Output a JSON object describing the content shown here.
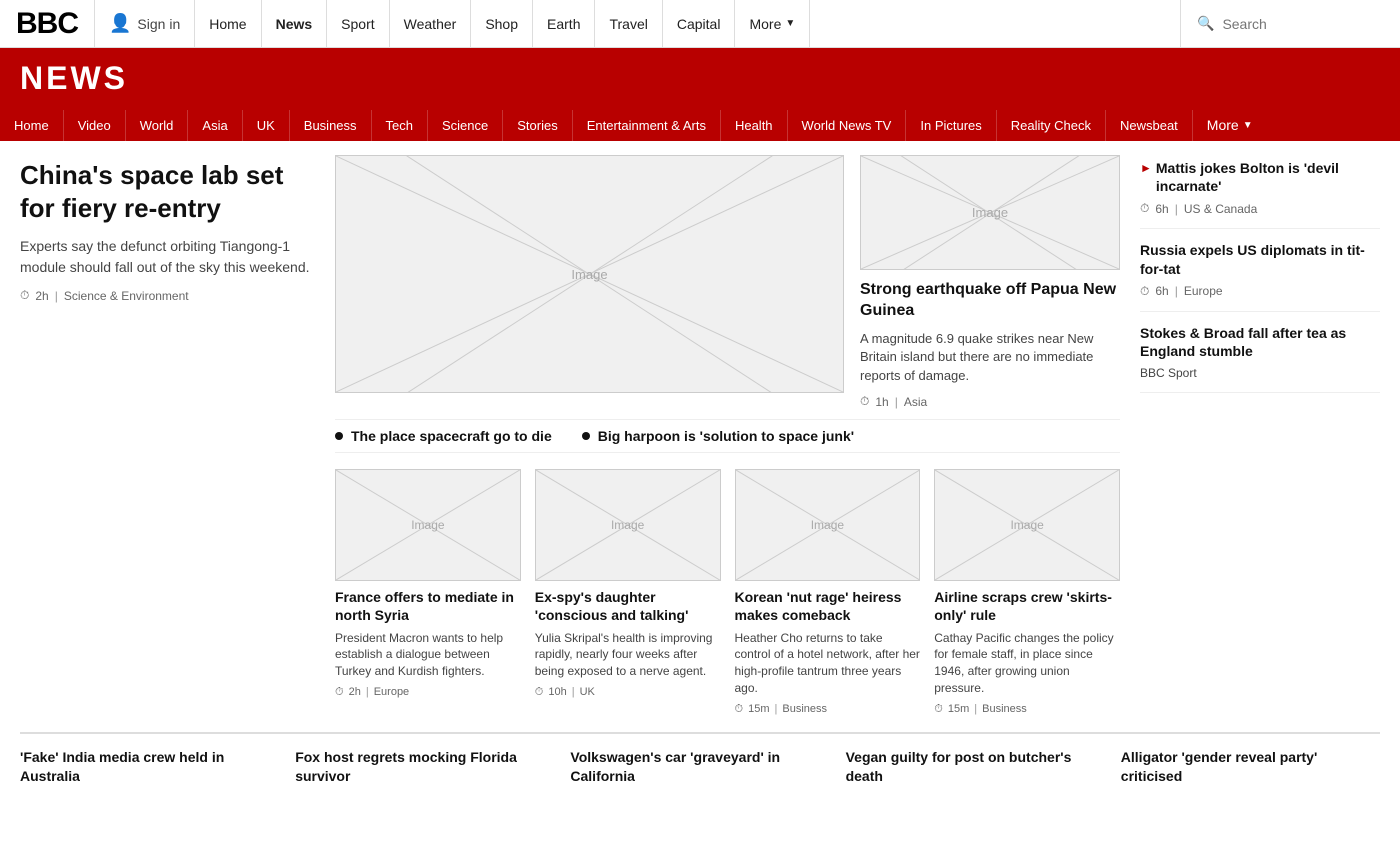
{
  "topNav": {
    "logo": "BBC",
    "signIn": "Sign in",
    "links": [
      {
        "label": "Home",
        "active": false
      },
      {
        "label": "News",
        "active": true
      },
      {
        "label": "Sport",
        "active": false
      },
      {
        "label": "Weather",
        "active": false
      },
      {
        "label": "Shop",
        "active": false
      },
      {
        "label": "Earth",
        "active": false
      },
      {
        "label": "Travel",
        "active": false
      },
      {
        "label": "Capital",
        "active": false
      }
    ],
    "more": "More",
    "search": "Search"
  },
  "newsBanner": {
    "title": "NEWS"
  },
  "subNav": {
    "links": [
      {
        "label": "Home",
        "active": false
      },
      {
        "label": "Video",
        "active": false
      },
      {
        "label": "World",
        "active": false
      },
      {
        "label": "Asia",
        "active": false
      },
      {
        "label": "UK",
        "active": false
      },
      {
        "label": "Business",
        "active": false
      },
      {
        "label": "Tech",
        "active": false
      },
      {
        "label": "Science",
        "active": false
      },
      {
        "label": "Stories",
        "active": false
      },
      {
        "label": "Entertainment & Arts",
        "active": false
      },
      {
        "label": "Health",
        "active": false
      },
      {
        "label": "World News TV",
        "active": false
      },
      {
        "label": "In Pictures",
        "active": false
      },
      {
        "label": "Reality Check",
        "active": false
      },
      {
        "label": "Newsbeat",
        "active": false
      }
    ],
    "more": "More"
  },
  "mainStory": {
    "headline": "China's space lab set for fiery re-entry",
    "description": "Experts say the defunct orbiting Tiangong-1 module should fall out of the sky this weekend.",
    "time": "2h",
    "category": "Science & Environment",
    "imageLabel": "Image"
  },
  "rightTopStory": {
    "headline": "Strong earthquake off Papua New Guinea",
    "description": "A magnitude 6.9 quake strikes near New Britain island but there are no immediate reports of damage.",
    "time": "1h",
    "category": "Asia",
    "imageLabel": "Image"
  },
  "bulletItems": [
    {
      "text": "The place spacecraft go to die"
    },
    {
      "text": "Big harpoon is 'solution to space junk'"
    }
  ],
  "gridItems": [
    {
      "title": "France offers to mediate in north Syria",
      "description": "President Macron wants to help establish a dialogue between Turkey and Kurdish fighters.",
      "time": "2h",
      "category": "Europe",
      "imageLabel": "Image"
    },
    {
      "title": "Ex-spy's daughter 'conscious and talking'",
      "description": "Yulia Skripal's health is improving rapidly, nearly four weeks after being exposed to a nerve agent.",
      "time": "10h",
      "category": "UK",
      "imageLabel": "Image"
    },
    {
      "title": "Korean 'nut rage' heiress makes comeback",
      "description": "Heather Cho returns to take control of a hotel network, after her high-profile tantrum three years ago.",
      "time": "15m",
      "category": "Business",
      "imageLabel": "Image"
    },
    {
      "title": "Airline scraps crew 'skirts-only' rule",
      "description": "Cathay Pacific changes the policy for female staff, in place since 1946, after growing union pressure.",
      "time": "15m",
      "category": "Business",
      "imageLabel": "Image"
    }
  ],
  "sidebarItems": [
    {
      "title": "Mattis jokes Bolton is 'devil incarnate'",
      "time": "6h",
      "category": "US & Canada",
      "hasArrow": true
    },
    {
      "title": "Russia expels US diplomats in tit-for-tat",
      "time": "6h",
      "category": "Europe",
      "hasArrow": false
    },
    {
      "title": "Stokes & Broad fall after tea as England stumble",
      "time": "",
      "category": "BBC Sport",
      "hasArrow": false,
      "isSport": true
    }
  ],
  "bottomItems": [
    {
      "title": "'Fake' India media crew held in Australia"
    },
    {
      "title": "Fox host regrets mocking Florida survivor"
    },
    {
      "title": "Volkswagen's car 'graveyard' in California"
    },
    {
      "title": "Vegan guilty for post on butcher's death"
    },
    {
      "title": "Alligator 'gender reveal party' criticised"
    }
  ]
}
